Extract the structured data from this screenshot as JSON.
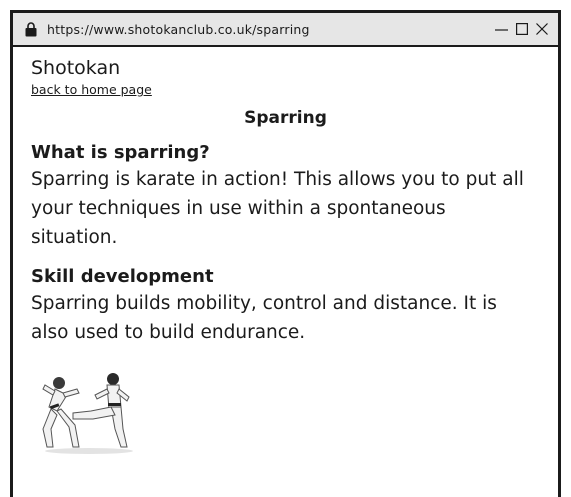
{
  "browser": {
    "url": "https://www.shotokanclub.co.uk/sparring",
    "lock_icon": "lock-icon",
    "minimize_icon": "minimize-icon",
    "maximize_icon": "maximize-icon",
    "close_icon": "close-icon"
  },
  "page": {
    "site_name": "Shotokan",
    "home_link": "back to home page",
    "title": "Sparring",
    "sections": [
      {
        "heading": "What is sparring?",
        "text": "Sparring is karate in action! This allows you to put all your techniques in use within a spontaneous situation."
      },
      {
        "heading": "Skill development",
        "text": "Sparring builds mobility, control and distance. It is also used to build endurance."
      }
    ],
    "image": "karate-sparring-photo"
  }
}
